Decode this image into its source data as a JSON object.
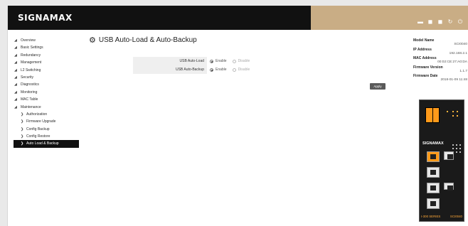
{
  "brand": {
    "name": "SIGNAMAX"
  },
  "top_icons": [
    {
      "name": "minimize-icon",
      "glyph": "▬"
    },
    {
      "name": "save-icon",
      "glyph": "◼"
    },
    {
      "name": "save-all-icon",
      "glyph": "◼"
    },
    {
      "name": "refresh-icon",
      "glyph": "↻"
    },
    {
      "name": "logout-icon",
      "glyph": "⏻"
    }
  ],
  "sidebar": {
    "items": [
      {
        "label": "Overview",
        "sub": false,
        "active": false
      },
      {
        "label": "Basic Settings",
        "sub": false,
        "active": false
      },
      {
        "label": "Redundancy",
        "sub": false,
        "active": false
      },
      {
        "label": "Management",
        "sub": false,
        "active": false
      },
      {
        "label": "L2 Switching",
        "sub": false,
        "active": false
      },
      {
        "label": "Security",
        "sub": false,
        "active": false
      },
      {
        "label": "Diagnostics",
        "sub": false,
        "active": false
      },
      {
        "label": "Monitoring",
        "sub": false,
        "active": false
      },
      {
        "label": "MAC Table",
        "sub": false,
        "active": false
      },
      {
        "label": "Maintenance",
        "sub": false,
        "active": false
      },
      {
        "label": "Authorization",
        "sub": true,
        "active": false
      },
      {
        "label": "Firmware Upgrade",
        "sub": true,
        "active": false
      },
      {
        "label": "Config Backup",
        "sub": true,
        "active": false
      },
      {
        "label": "Config Restore",
        "sub": true,
        "active": false
      },
      {
        "label": "Auto Load & Backup",
        "sub": true,
        "active": true
      }
    ]
  },
  "main": {
    "title": "USB Auto-Load & Auto-Backup",
    "rows": [
      {
        "label": "USB Auto-Load",
        "enable_label": "Enable",
        "disable_label": "Disable",
        "selected": "enable"
      },
      {
        "label": "USB Auto-Backup",
        "enable_label": "Enable",
        "disable_label": "Disable",
        "selected": "enable"
      }
    ],
    "apply_label": "Apply"
  },
  "info": {
    "model_name_label": "Model Name",
    "model_name": "SCI0040",
    "ip_label": "IP Address",
    "ip": "192.168.2.1",
    "mac_label": "MAC Address",
    "mac": "00:02:CE:27:A0:DA",
    "fw_version_label": "Firmware Version",
    "fw_version": "1.1.7",
    "fw_date_label": "Firmware Date",
    "fw_date": "2018-01-09 11:48"
  },
  "device": {
    "brand": "SIGNAMAX",
    "series": "I-300 SERIES",
    "model": "SCI0040"
  },
  "colors": {
    "topbar": "#111111",
    "topbar_accent": "#c9ad85",
    "device_orange": "#ff9a1a"
  }
}
